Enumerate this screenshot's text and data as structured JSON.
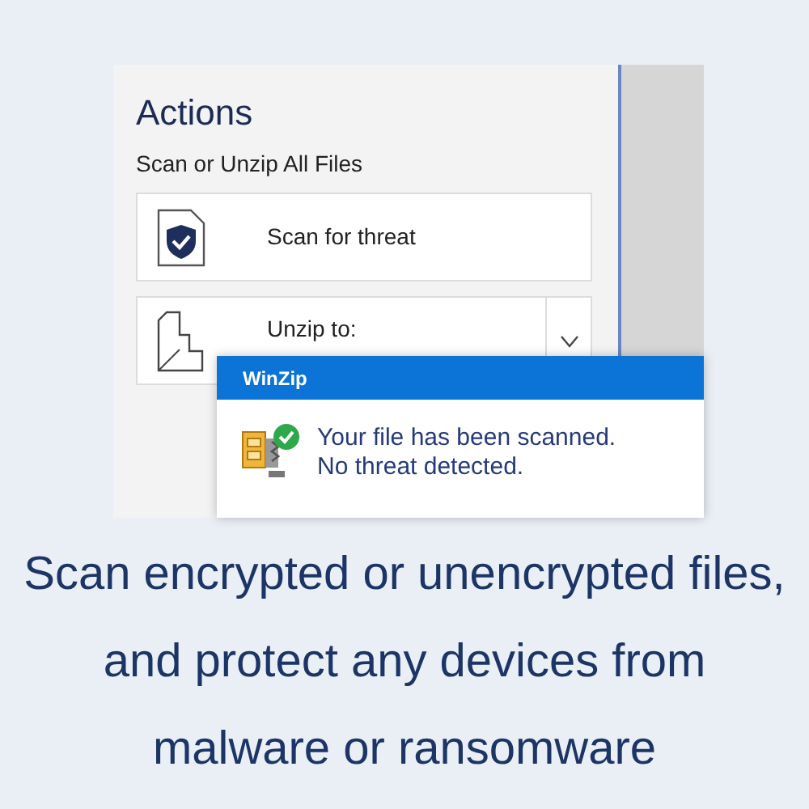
{
  "panel": {
    "title": "Actions",
    "section": "Scan or Unzip All Files",
    "actions": [
      {
        "kind": "scan",
        "label": "Scan for threat"
      },
      {
        "kind": "unzip",
        "label": "Unzip to:"
      }
    ]
  },
  "dialog": {
    "title": "WinZip",
    "message": [
      "Your file has been scanned.",
      "No threat detected."
    ]
  },
  "caption": "Scan encrypted or unencrypted files, and protect any devices from malware or ransomware"
}
